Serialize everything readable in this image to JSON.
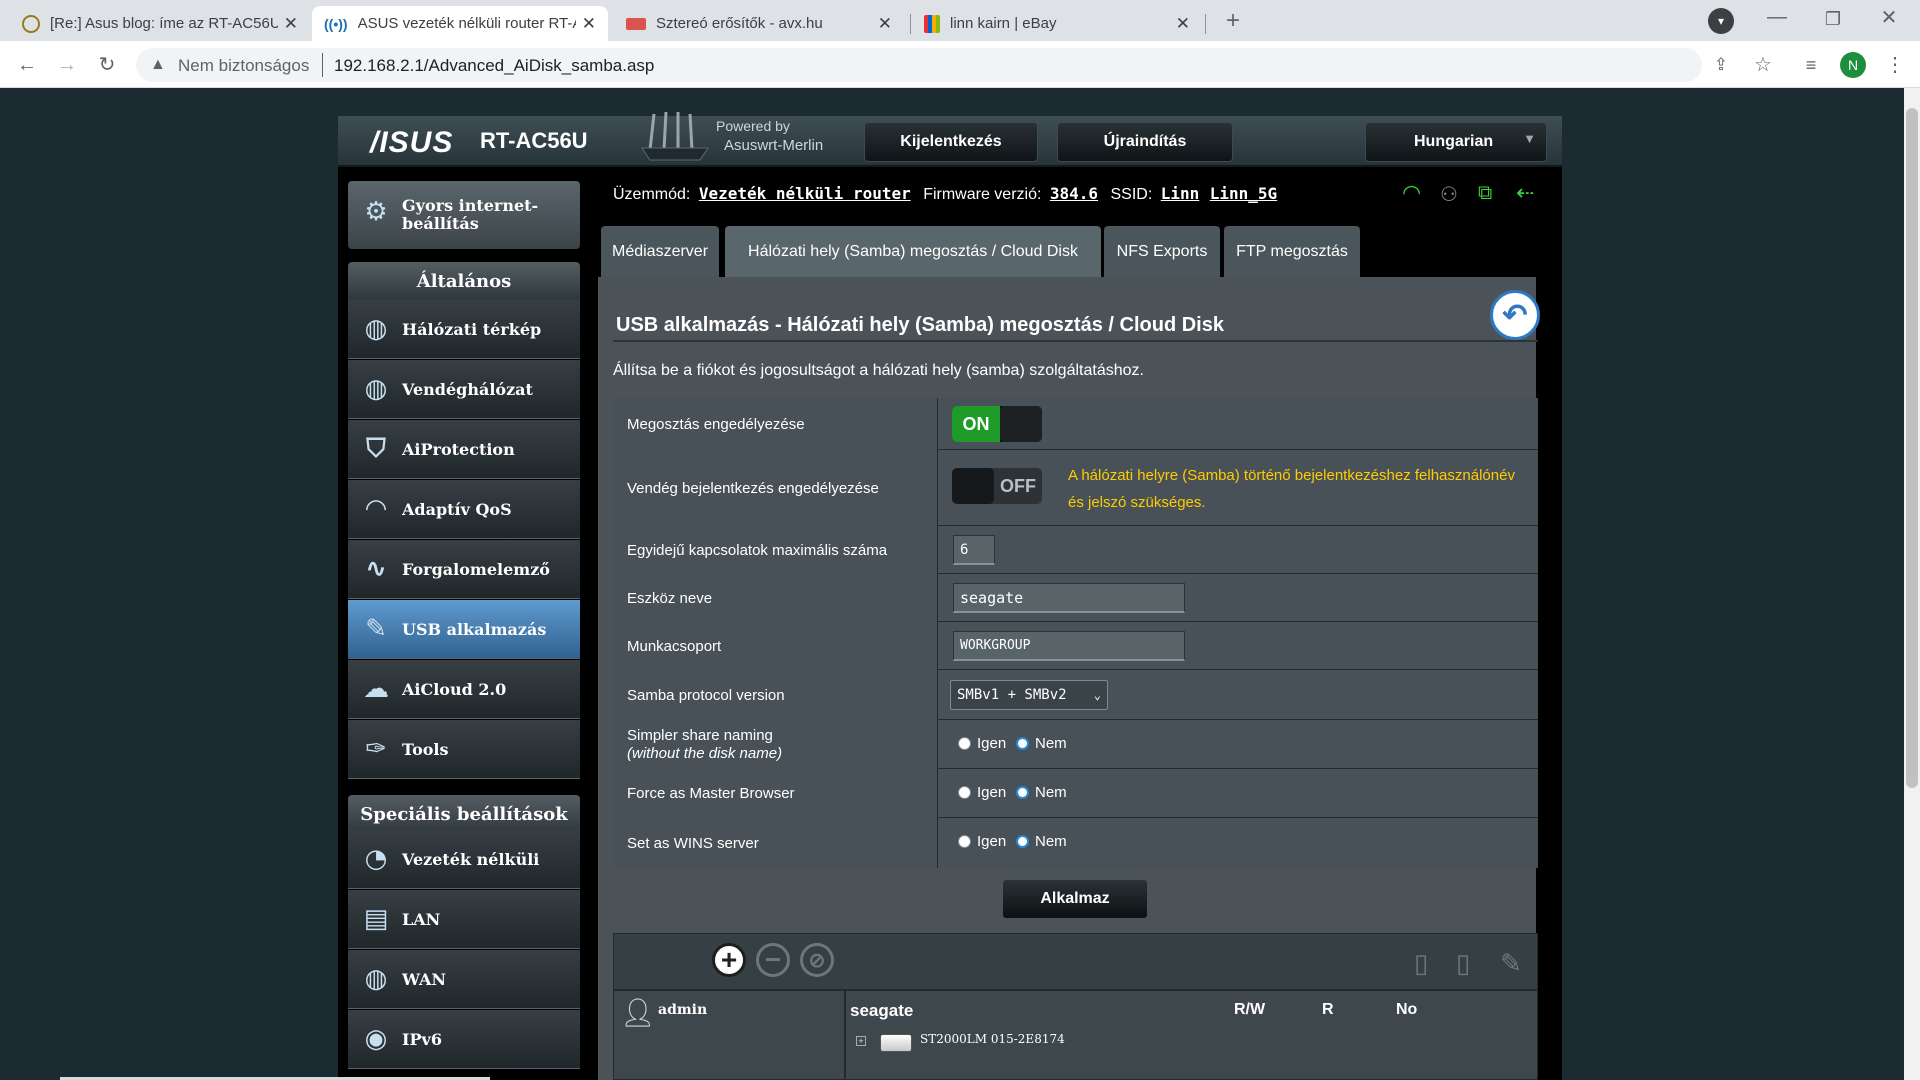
{
  "browser": {
    "tabs": [
      {
        "title": "[Re:] Asus blog: íme az RT-AC56U",
        "favicon": "chat-icon"
      },
      {
        "title": "ASUS vezeték nélküli router RT-A",
        "favicon": "wifi-icon"
      },
      {
        "title": "Sztereó erősítők - avx.hu",
        "favicon": "avx-icon"
      },
      {
        "title": "linn kairn | eBay",
        "favicon": "bag-icon"
      }
    ],
    "security_label": "Nem biztonságos",
    "url": "192.168.2.1/Advanced_AiDisk_samba.asp",
    "profile_initial": "N"
  },
  "router": {
    "brand": "/ISUS",
    "model": "RT-AC56U",
    "powered_by": "Powered by",
    "firmware_brand": "Asuswrt-Merlin",
    "logout": "Kijelentkezés",
    "reboot": "Újraindítás",
    "language": "Hungarian",
    "status": {
      "mode_label": "Üzemmód:",
      "mode_value": "Vezeték nélküli router",
      "fw_label": "Firmware verzió:",
      "fw_value": "384.6",
      "ssid_label": "SSID:",
      "ssid1": "Linn",
      "ssid2": "Linn_5G"
    }
  },
  "sidebar": {
    "quick_setup": "Gyors internet-beállítás",
    "general_header": "Általános",
    "general_items": [
      {
        "label": "Hálózati térkép",
        "icon": "network-map-icon"
      },
      {
        "label": "Vendéghálózat",
        "icon": "guest-network-icon"
      },
      {
        "label": "AiProtection",
        "icon": "shield-lock-icon"
      },
      {
        "label": "Adaptív QoS",
        "icon": "speedometer-icon"
      },
      {
        "label": "Forgalomelemző",
        "icon": "traffic-analyzer-icon"
      },
      {
        "label": "USB alkalmazás",
        "icon": "usb-icon"
      },
      {
        "label": "AiCloud 2.0",
        "icon": "cloud-icon"
      },
      {
        "label": "Tools",
        "icon": "wrench-icon"
      }
    ],
    "advanced_header": "Speciális beállítások",
    "advanced_items": [
      {
        "label": "Vezeték nélküli",
        "icon": "wireless-icon"
      },
      {
        "label": "LAN",
        "icon": "lan-icon"
      },
      {
        "label": "WAN",
        "icon": "globe-icon"
      },
      {
        "label": "IPv6",
        "icon": "ipv6-icon"
      }
    ]
  },
  "tabs": [
    "Médiaszerver",
    "Hálózati hely (Samba) megosztás / Cloud Disk",
    "NFS Exports",
    "FTP megosztás"
  ],
  "content": {
    "title": "USB alkalmazás - Hálózati hely (Samba) megosztás / Cloud Disk",
    "description": "Állítsa be a fiókot és jogosultságot a hálózati hely (samba) szolgáltatáshoz.",
    "rows": {
      "share_enable": {
        "label": "Megosztás engedélyezése",
        "state": "ON"
      },
      "guest_login": {
        "label": "Vendég bejelentkezés engedélyezése",
        "state": "OFF",
        "note": "A hálózati helyre (Samba) történő bejelentkezéshez felhasználónév és jelszó szükséges."
      },
      "max_conn": {
        "label": "Egyidejű kapcsolatok maximális száma",
        "value": "6"
      },
      "device_name": {
        "label": "Eszköz neve",
        "value": "seagate"
      },
      "workgroup": {
        "label": "Munkacsoport",
        "value": "WORKGROUP"
      },
      "protocol": {
        "label": "Samba protocol version",
        "value": "SMBv1 + SMBv2"
      },
      "simpler_naming": {
        "label": "Simpler share naming",
        "sublabel": "(without the disk name)"
      },
      "master_browser": {
        "label": "Force as Master Browser"
      },
      "wins": {
        "label": "Set as WINS server"
      }
    },
    "yes": "Igen",
    "no": "Nem",
    "apply": "Alkalmaz",
    "account_panel": {
      "user": "admin",
      "share": "seagate",
      "col_rw": "R/W",
      "col_r": "R",
      "col_no": "No",
      "disk": "ST2000LM 015-2E8174"
    }
  },
  "colors": {
    "accent_orange": "#ffcc00",
    "on_green": "#1f9b2a",
    "active_menu": "#4a86bd"
  }
}
